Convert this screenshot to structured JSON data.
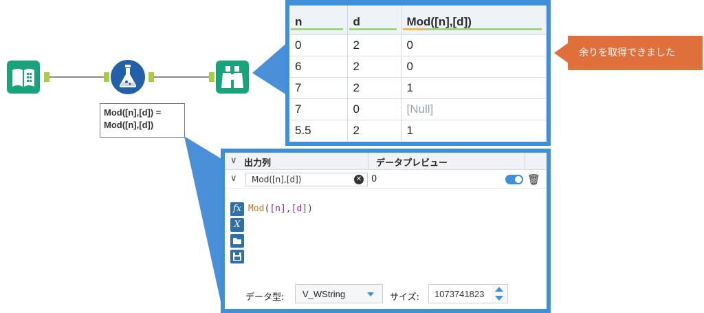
{
  "workflow": {
    "tools": [
      {
        "name": "input-data",
        "icon": "book-icon"
      },
      {
        "name": "formula",
        "icon": "flask-icon"
      },
      {
        "name": "browse",
        "icon": "binoculars-icon"
      }
    ],
    "formula_label": "Mod([n],[d]) =\nMod([n],[d])"
  },
  "results": {
    "columns": [
      "n",
      "d",
      "Mod([n],[d])"
    ],
    "rows": [
      [
        "0",
        "2",
        "0"
      ],
      [
        "6",
        "2",
        "0"
      ],
      [
        "7",
        "2",
        "1"
      ],
      [
        "7",
        "0",
        "[Null]"
      ],
      [
        "5.5",
        "2",
        "1"
      ]
    ]
  },
  "note": {
    "text": "余りを取得できました"
  },
  "config": {
    "header_output": "出力列",
    "header_preview": "データプレビュー",
    "field_value": "Mod([n],[d])",
    "preview_value": "0",
    "expression_fn": "Mod",
    "expression_args": [
      "[n]",
      "[d]"
    ],
    "side_tools": [
      "fx",
      "X",
      "folder-open-icon",
      "save-icon"
    ],
    "type_label": "データ型:",
    "type_value": "V_WString",
    "size_label": "サイズ:",
    "size_value": "1073741823"
  },
  "colors": {
    "accent": "#3f8fd9",
    "tool_green": "#1aa37a",
    "anchor": "#a6cc3f",
    "note": "#e0703b"
  }
}
